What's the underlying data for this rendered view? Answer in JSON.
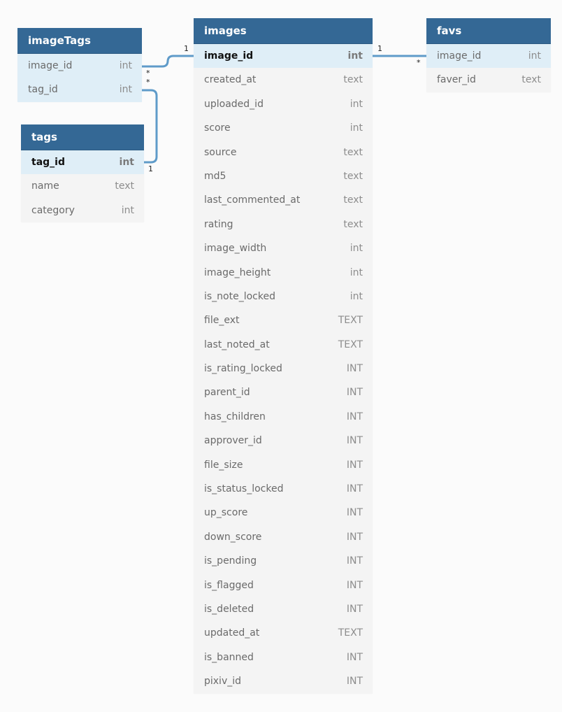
{
  "tables": {
    "imageTags": {
      "title": "imageTags",
      "rows": [
        {
          "name": "image_id",
          "type": "int"
        },
        {
          "name": "tag_id",
          "type": "int"
        }
      ]
    },
    "tags": {
      "title": "tags",
      "rows": [
        {
          "name": "tag_id",
          "type": "int"
        },
        {
          "name": "name",
          "type": "text"
        },
        {
          "name": "category",
          "type": "int"
        }
      ]
    },
    "images": {
      "title": "images",
      "rows": [
        {
          "name": "image_id",
          "type": "int"
        },
        {
          "name": "created_at",
          "type": "text"
        },
        {
          "name": "uploaded_id",
          "type": "int"
        },
        {
          "name": "score",
          "type": "int"
        },
        {
          "name": "source",
          "type": "text"
        },
        {
          "name": "md5",
          "type": "text"
        },
        {
          "name": "last_commented_at",
          "type": "text"
        },
        {
          "name": "rating",
          "type": "text"
        },
        {
          "name": "image_width",
          "type": "int"
        },
        {
          "name": "image_height",
          "type": "int"
        },
        {
          "name": "is_note_locked",
          "type": "int"
        },
        {
          "name": "file_ext",
          "type": "TEXT"
        },
        {
          "name": "last_noted_at",
          "type": "TEXT"
        },
        {
          "name": "is_rating_locked",
          "type": "INT"
        },
        {
          "name": "parent_id",
          "type": "INT"
        },
        {
          "name": "has_children",
          "type": "INT"
        },
        {
          "name": "approver_id",
          "type": "INT"
        },
        {
          "name": "file_size",
          "type": "INT"
        },
        {
          "name": "is_status_locked",
          "type": "INT"
        },
        {
          "name": "up_score",
          "type": "INT"
        },
        {
          "name": "down_score",
          "type": "INT"
        },
        {
          "name": "is_pending",
          "type": "INT"
        },
        {
          "name": "is_flagged",
          "type": "INT"
        },
        {
          "name": "is_deleted",
          "type": "INT"
        },
        {
          "name": "updated_at",
          "type": "TEXT"
        },
        {
          "name": "is_banned",
          "type": "INT"
        },
        {
          "name": "pixiv_id",
          "type": "INT"
        }
      ]
    },
    "favs": {
      "title": "favs",
      "rows": [
        {
          "name": "image_id",
          "type": "int"
        },
        {
          "name": "faver_id",
          "type": "text"
        }
      ]
    }
  },
  "relations": [
    {
      "from": "imageTags.image_id",
      "to": "images.image_id",
      "from_card": "*",
      "to_card": "1"
    },
    {
      "from": "imageTags.tag_id",
      "to": "tags.tag_id",
      "from_card": "*",
      "to_card": "1"
    },
    {
      "from": "favs.image_id",
      "to": "images.image_id",
      "from_card": "*",
      "to_card": "1"
    }
  ],
  "colors": {
    "header": "#346895",
    "highlight_row": "#dfeef7",
    "body": "#f4f4f4",
    "connector": "#5f9bc9"
  }
}
